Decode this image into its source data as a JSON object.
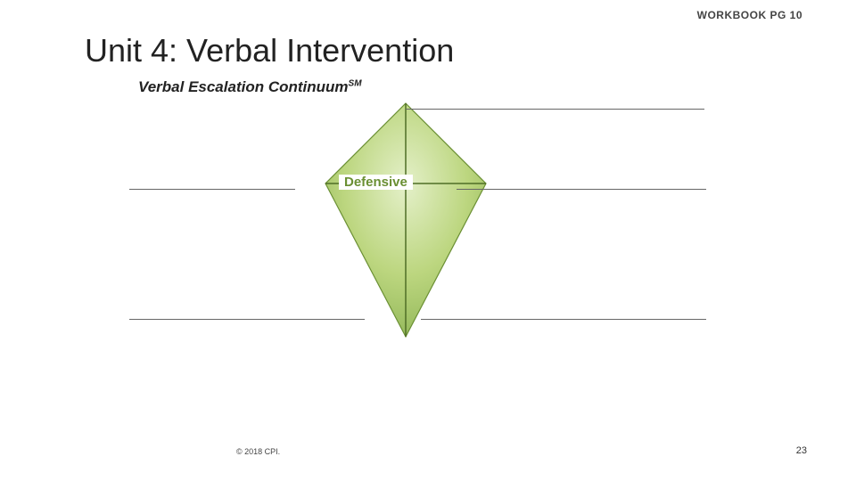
{
  "header": {
    "workbook_label": "WORKBOOK PG 10"
  },
  "title": "Unit 4: Verbal Intervention",
  "subtitle_main": "Verbal Escalation Continuum",
  "subtitle_mark": "SM",
  "diagram": {
    "center_label": "Defensive",
    "colors": {
      "fill_light": "#cde0a8",
      "fill_dark": "#8fb556",
      "stroke": "#6a8f33"
    }
  },
  "footer": {
    "copyright": "© 2018 CPI.",
    "page_number": "23"
  }
}
